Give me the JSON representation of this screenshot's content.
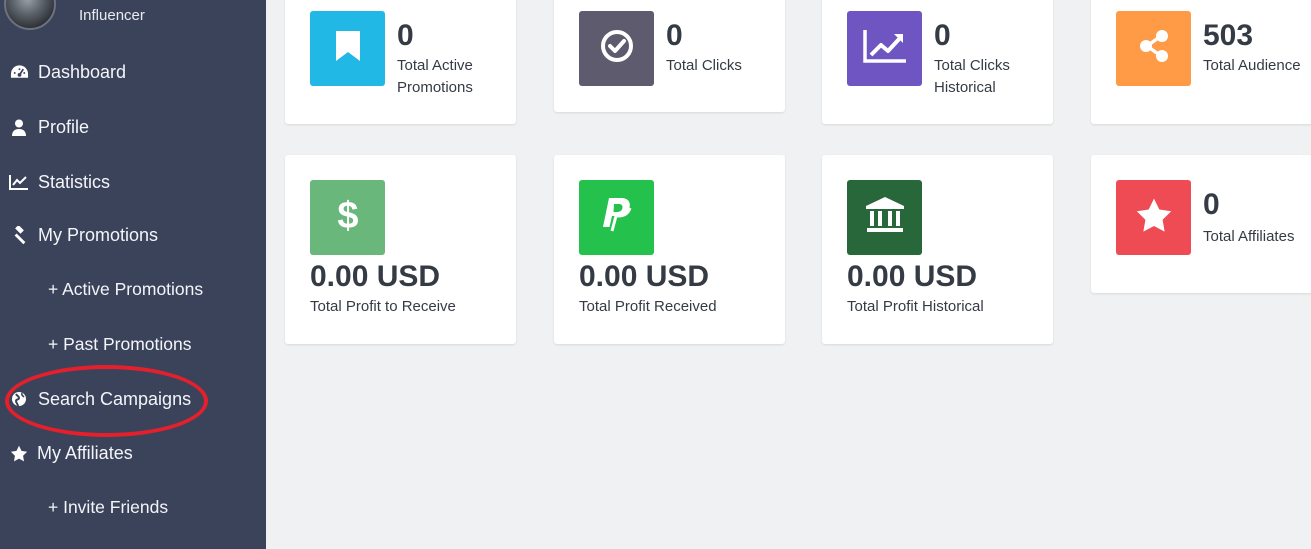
{
  "user": {
    "role": "Influencer"
  },
  "nav": {
    "dashboard": "Dashboard",
    "profile": "Profile",
    "statistics": "Statistics",
    "my_promotions": "My Promotions",
    "active_promotions": "+ Active Promotions",
    "past_promotions": "+ Past Promotions",
    "search_campaigns": "Search Campaigns",
    "my_affiliates": "My Affiliates",
    "invite_friends": "+ Invite Friends"
  },
  "stats": {
    "active_promotions": {
      "value": "0",
      "label": "Total Active Promotions",
      "color": "#22b8e6",
      "icon": "bookmark-icon"
    },
    "clicks": {
      "value": "0",
      "label": "Total Clicks",
      "color": "#5f5b6f",
      "icon": "check-circle-icon"
    },
    "clicks_historical": {
      "value": "0",
      "label": "Total Clicks Historical",
      "color": "#6e55c2",
      "icon": "line-chart-icon"
    },
    "audience": {
      "value": "503",
      "label": "Total Audience",
      "color": "#ff9a47",
      "icon": "share-icon"
    },
    "profit_to_receive": {
      "value": "0.00 USD",
      "label": "Total Profit to Receive",
      "color": "#69b77b",
      "icon": "dollar-icon"
    },
    "profit_received": {
      "value": "0.00 USD",
      "label": "Total Profit Received",
      "color": "#24c24d",
      "icon": "paypal-icon"
    },
    "profit_historical": {
      "value": "0.00 USD",
      "label": "Total Profit Historical",
      "color": "#27673a",
      "icon": "bank-icon"
    },
    "affiliates": {
      "value": "0",
      "label": "Total Affiliates",
      "color": "#ef4b55",
      "icon": "star-icon"
    }
  },
  "colors": {
    "sidebar": "#3a435a",
    "background": "#eff1f2",
    "highlight_ring": "#e5202c"
  }
}
